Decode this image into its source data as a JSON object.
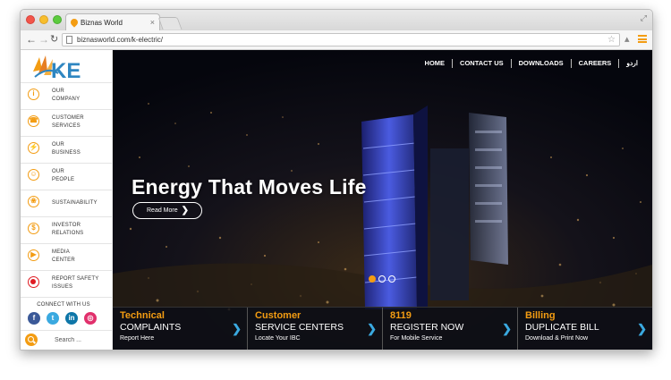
{
  "browser": {
    "tab_title": "Biznas World",
    "tab_close": "×",
    "url": "biznasworld.com/k-electric/",
    "back": "←",
    "forward": "→",
    "reload": "↻",
    "star": "☆",
    "resize": "⤢"
  },
  "sidebar": {
    "logo_text": "KE",
    "items": [
      {
        "label": "Our\nCompany",
        "icon": "info-icon",
        "glyph": "i"
      },
      {
        "label": "Customer\nServices",
        "icon": "headset-icon",
        "glyph": "☎"
      },
      {
        "label": "Our\nBusiness",
        "icon": "tower-icon",
        "glyph": "⚡"
      },
      {
        "label": "Our\nPeople",
        "icon": "people-icon",
        "glyph": "☺"
      },
      {
        "label": "Sustainability",
        "icon": "leaf-icon",
        "glyph": "❀"
      },
      {
        "label": "Investor\nRelations",
        "icon": "chart-icon",
        "glyph": "$"
      },
      {
        "label": "Media\nCenter",
        "icon": "play-icon",
        "glyph": "▶"
      },
      {
        "label": "Report Safety\nIssues",
        "icon": "alert-icon",
        "glyph": ""
      }
    ],
    "connect_label": "CONNECT WITH US",
    "social": {
      "facebook": "f",
      "twitter": "t",
      "linkedin": "in",
      "instagram": "◎"
    },
    "search_placeholder": "Search ..."
  },
  "topnav": [
    "HOME",
    "CONTACT US",
    "DOWNLOADS",
    "CAREERS",
    "اردو"
  ],
  "hero": {
    "title": "Energy That Moves Life",
    "read_more": "Read More",
    "chevron": "❯",
    "slide_count": 3,
    "active_slide": 1
  },
  "tiles": [
    {
      "category": "Technical",
      "main": "COMPLAINTS",
      "sub": "Report Here",
      "arrow": "❯"
    },
    {
      "category": "Customer",
      "main": "SERVICE CENTERS",
      "sub": "Locate Your IBC",
      "arrow": "❯"
    },
    {
      "category": "8119",
      "main": "REGISTER NOW",
      "sub": "For Mobile Service",
      "arrow": "❯"
    },
    {
      "category": "Billing",
      "main": "DUPLICATE BILL",
      "sub": "Download & Print Now",
      "arrow": "❯"
    }
  ],
  "colors": {
    "accent": "#f39c12",
    "tile_arrow": "#3aa9e0",
    "safety": "#e01b22"
  }
}
